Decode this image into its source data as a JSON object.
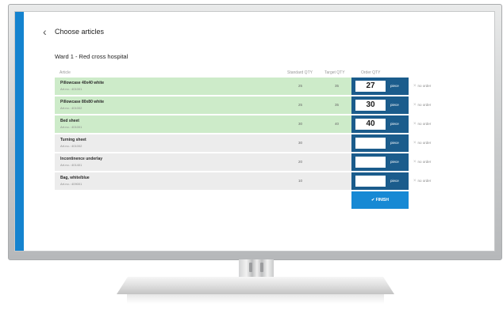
{
  "header": {
    "back_icon": "chevron-left-icon",
    "title": "Choose articles",
    "ward_title": "Ward 1 - Red cross hospital"
  },
  "table": {
    "columns": {
      "article": "Article",
      "standard_qty": "Standard QTY",
      "target_qty": "Target QTY",
      "order_qty": "Order QTY"
    },
    "rows": [
      {
        "name": "Pillowcase 40x40 white",
        "art_no": "Art.no.: 401001",
        "standard_qty": "25",
        "target_qty": "35",
        "order_qty": "27",
        "unit": "piece",
        "no_order": "no order"
      },
      {
        "name": "Pillowcase 80x80 white",
        "art_no": "Art.no.: 401002",
        "standard_qty": "25",
        "target_qty": "35",
        "order_qty": "30",
        "unit": "piece",
        "no_order": "no order"
      },
      {
        "name": "Bed sheet",
        "art_no": "Art.no.: 401001",
        "standard_qty": "30",
        "target_qty": "40",
        "order_qty": "40",
        "unit": "piece",
        "no_order": "no order"
      },
      {
        "name": "Turning sheet",
        "art_no": "Art.no.: 401002",
        "standard_qty": "30",
        "target_qty": "",
        "order_qty": "",
        "unit": "piece",
        "no_order": "no order"
      },
      {
        "name": "Incontinence underlay",
        "art_no": "Art.no.: 401401",
        "standard_qty": "20",
        "target_qty": "",
        "order_qty": "",
        "unit": "piece",
        "no_order": "no order"
      },
      {
        "name": "Bag, white/blue",
        "art_no": "Art.no.: 409001",
        "standard_qty": "10",
        "target_qty": "",
        "order_qty": "",
        "unit": "piece",
        "no_order": "no order"
      }
    ]
  },
  "actions": {
    "finish_label": "✔ FINISH",
    "no_order_icon": "close-icon"
  },
  "colors": {
    "accent": "#1483cf",
    "order_cell": "#1b5c8c",
    "finish_button": "#1789d4",
    "filled_row": "#cdebc9",
    "empty_row": "#ececec"
  }
}
